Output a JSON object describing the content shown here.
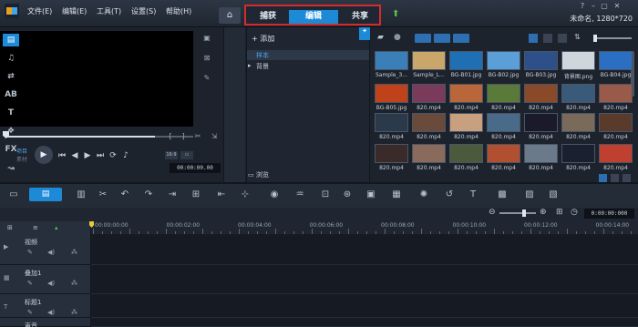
{
  "menu": {
    "items": [
      "文件(E)",
      "编辑(E)",
      "工具(T)",
      "设置(S)",
      "帮助(H)"
    ]
  },
  "tabs": {
    "capture": "捕获",
    "edit": "编辑",
    "share": "共享"
  },
  "project": {
    "info": "未命名, 1280*720"
  },
  "player": {
    "mode_project": "项目",
    "mode_clip": "素材",
    "aspect": "16:9",
    "timecode": "00:00:00.00"
  },
  "library": {
    "add_label": "添加",
    "folders": [
      "样本",
      "背景"
    ],
    "browse_label": "浏览"
  },
  "media": {
    "rows": [
      [
        "Sample_3...",
        "Sample_L...",
        "BG-B01.jpg",
        "BG-B02.jpg",
        "BG-B03.jpg",
        "背景图.png",
        "BG-B04.jpg"
      ],
      [
        "BG-B05.jpg",
        "820.mp4",
        "820.mp4",
        "820.mp4",
        "820.mp4",
        "820.mp4",
        "820.mp4"
      ],
      [
        "820.mp4",
        "820.mp4",
        "820.mp4",
        "820.mp4",
        "820.mp4",
        "820.mp4",
        "820.mp4"
      ],
      [
        "820.mp4",
        "820.mp4",
        "820.mp4",
        "820.mp4",
        "820.mp4",
        "820.mp4",
        "820.mp4"
      ]
    ],
    "thumb_colors": [
      [
        "#3b7fb8",
        "#c9a76a",
        "#1e6fb3",
        "#5a9fd8",
        "#2d4f8a",
        "#cfd6dc",
        "#2a6fc2"
      ],
      [
        "#c0421a",
        "#7a3a5a",
        "#b8663a",
        "#5a7a3a",
        "#8a4a2a",
        "#3a5a7a",
        "#9a5a4a"
      ],
      [
        "#2a3a4a",
        "#6a4a3a",
        "#c8a080",
        "#4a6a8a",
        "#1a1a2a",
        "#7a6a5a",
        "#5a3a2a"
      ],
      [
        "#3a2a2a",
        "#8a6a5a",
        "#4a5a3a",
        "#b05030",
        "#6a7a8a",
        "#1a2030",
        "#c04030"
      ]
    ]
  },
  "timeline": {
    "ruler": [
      "00:00:00:00",
      "00:00:02:00",
      "00:00:04:00",
      "00:00:06:00",
      "00:00:08:00",
      "00:00:10:00",
      "00:00:12:00",
      "00:00:14:00"
    ],
    "timecode": "0:00:00:000",
    "tracks": [
      "视频",
      "叠加1",
      "标题1",
      "声音"
    ]
  }
}
